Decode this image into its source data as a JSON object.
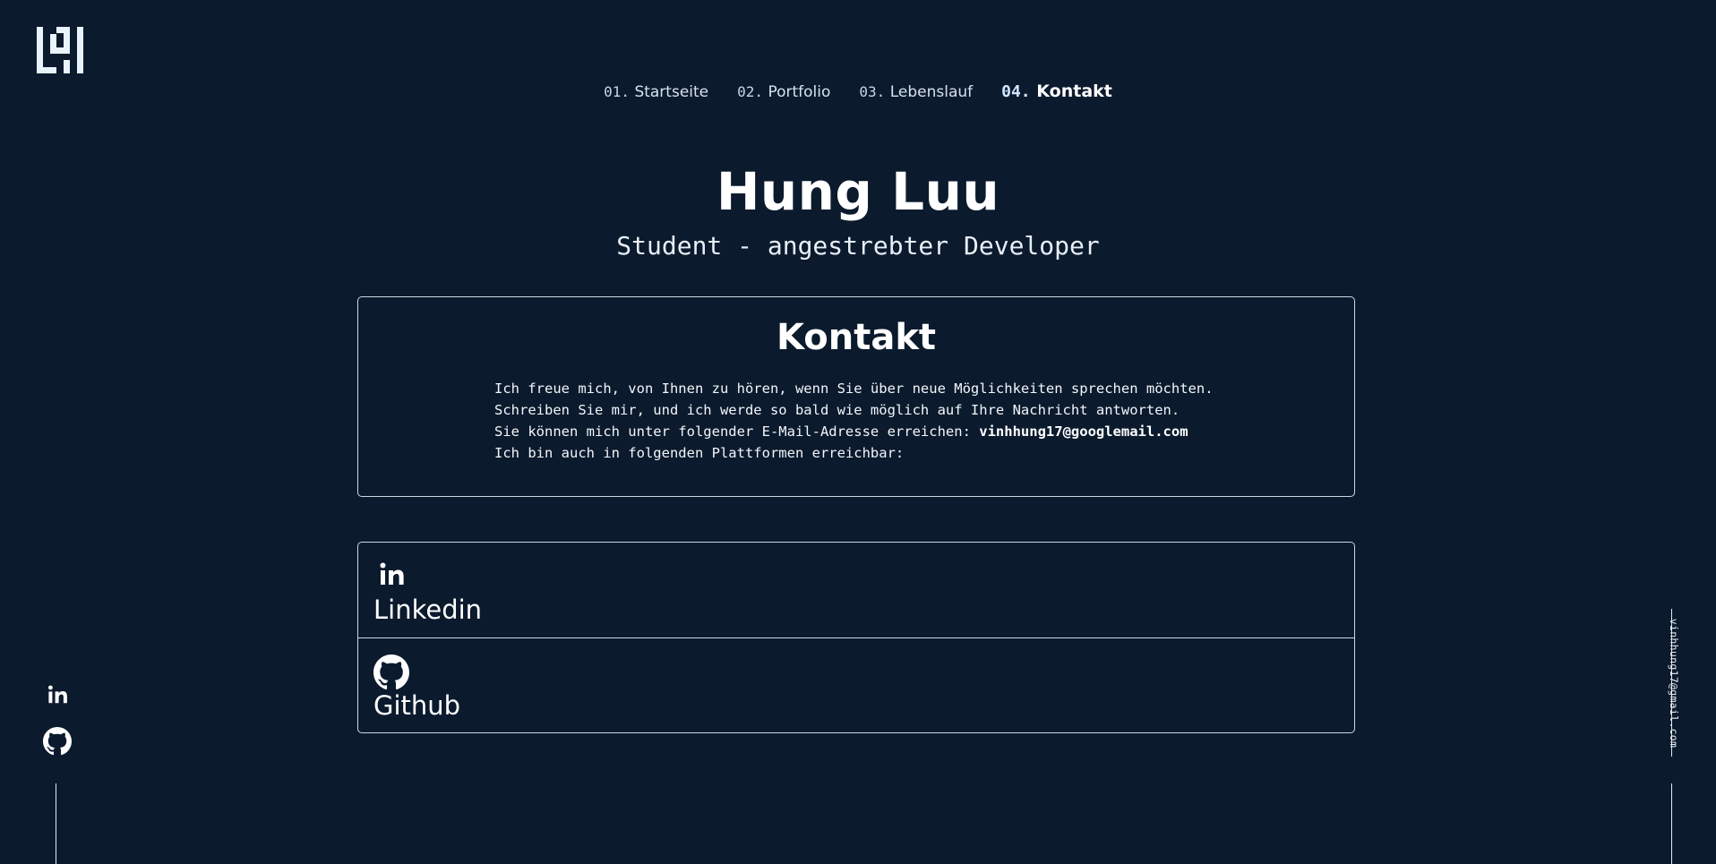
{
  "nav": {
    "items": [
      {
        "num": "01.",
        "label": "Startseite",
        "active": false
      },
      {
        "num": "02.",
        "label": "Portfolio",
        "active": false
      },
      {
        "num": "03.",
        "label": "Lebenslauf",
        "active": false
      },
      {
        "num": "04.",
        "label": "Kontakt",
        "active": true
      }
    ]
  },
  "hero": {
    "name": "Hung Luu",
    "subtitle": "Student - angestrebter Developer"
  },
  "contact": {
    "title": "Kontakt",
    "lines": [
      "Ich freue mich, von Ihnen zu hören, wenn Sie über neue Möglichkeiten sprechen möchten.",
      "Schreiben Sie mir, und ich werde so bald wie möglich auf Ihre Nachricht antworten.",
      "Sie können mich unter folgender E-Mail-Adresse erreichen: ",
      "Ich bin auch in folgenden Plattformen erreichbar:"
    ],
    "email": "vinhhung17@googlemail.com"
  },
  "platforms": [
    {
      "label": "Linkedin",
      "icon": "linkedin-icon"
    },
    {
      "label": "Github",
      "icon": "github-icon"
    }
  ],
  "side": {
    "email": "vinhhung17@gmail.com"
  },
  "colors": {
    "background": "#0b1a2d",
    "text": "#ffffff",
    "border": "#cfd8e3"
  }
}
